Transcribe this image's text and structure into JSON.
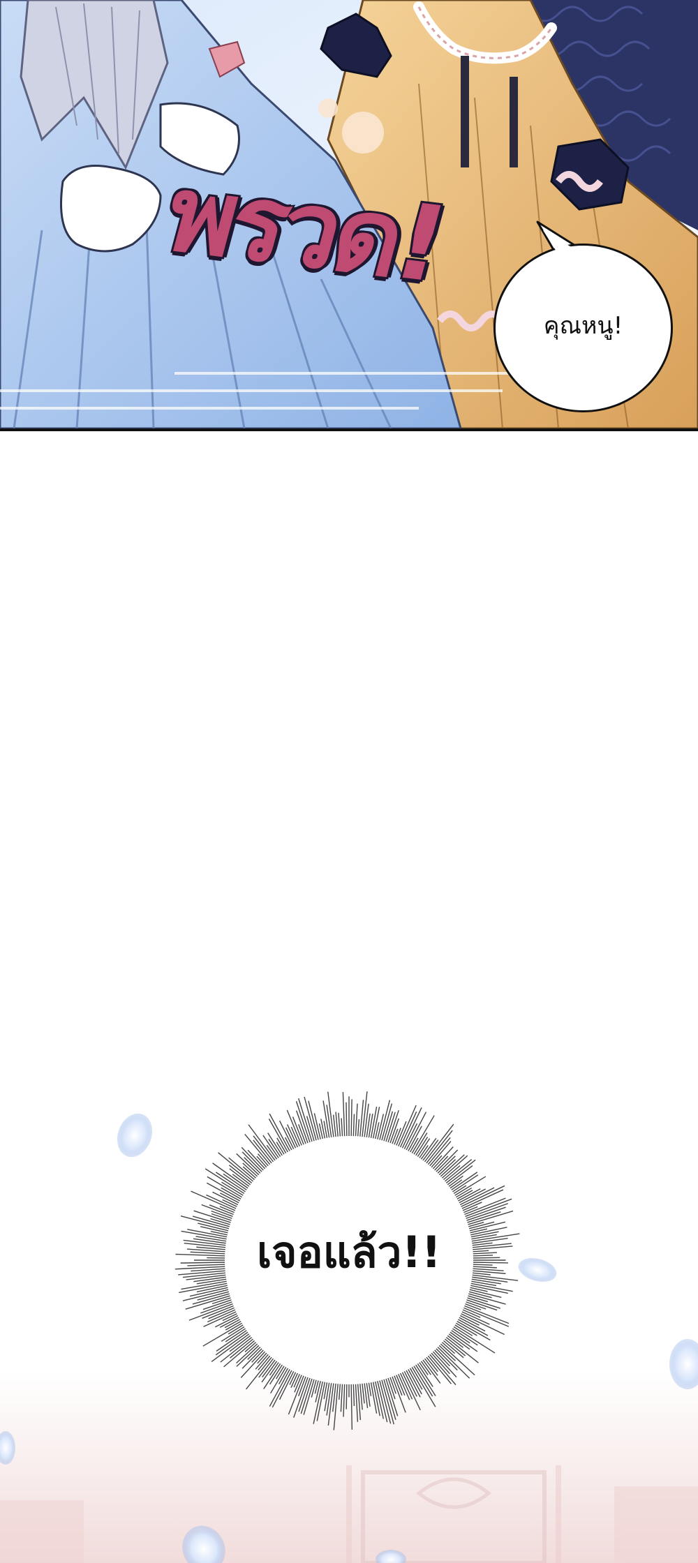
{
  "panel_top": {
    "sound_effect": "พรวด!",
    "speech_bubble": "คุณหนู!",
    "colors": {
      "sound_effect_fill": "#c04b72",
      "sound_effect_outline": "#1f1730",
      "dress_blue": "#a9c7ee",
      "dress_gold": "#e6b56c",
      "background_blue": "#2c3466"
    }
  },
  "panel_bottom": {
    "burst_text": "เจอแล้ว!!",
    "colors": {
      "burst_lines": "#444444",
      "petal_blue": "#c8daf7",
      "room_tint": "#f3e4e2"
    }
  }
}
